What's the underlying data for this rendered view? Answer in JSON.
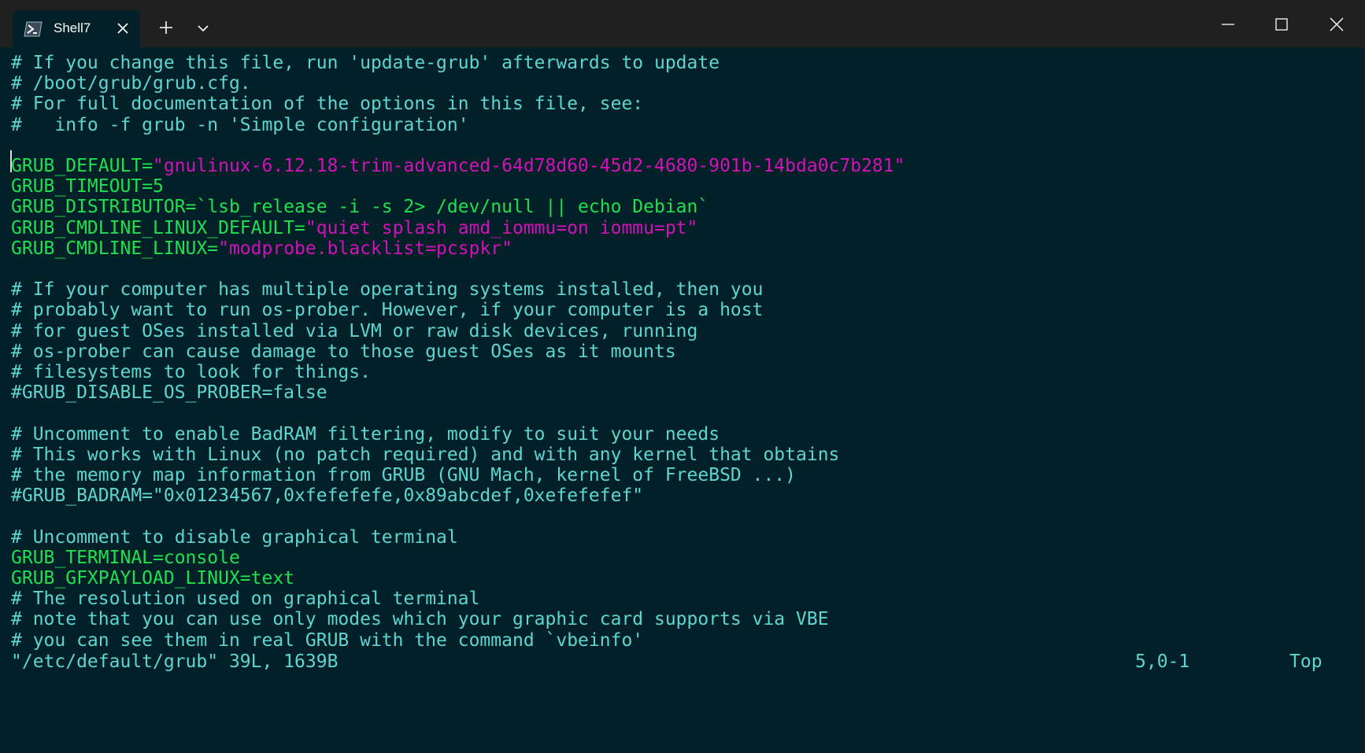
{
  "window": {
    "tab_title": "Shell7"
  },
  "icons": {
    "tab_icon": "powershell-icon",
    "tab_close": "close-icon",
    "new_tab": "plus-icon",
    "dropdown": "chevron-down-icon",
    "minimize": "minimize-icon",
    "maximize": "maximize-icon",
    "close": "close-icon"
  },
  "colors": {
    "background": "#012028",
    "comment": "#5dd6d2",
    "keyword": "#1fe04f",
    "string": "#d411b8",
    "titlebar": "#202020"
  },
  "editor": {
    "lines": [
      [
        {
          "t": "# If you change this file, run 'update-grub' afterwards to update",
          "c": "cm"
        }
      ],
      [
        {
          "t": "# /boot/grub/grub.cfg.",
          "c": "cm"
        }
      ],
      [
        {
          "t": "# For full documentation of the options in this file, see:",
          "c": "cm"
        }
      ],
      [
        {
          "t": "#   info -f grub -n 'Simple configuration'",
          "c": "cm"
        }
      ],
      [],
      [
        {
          "t": "GRUB_DEFAULT=",
          "c": "kw"
        },
        {
          "t": "\"gnulinux-6.12.18-trim-advanced-64d78d60-45d2-4680-901b-14bda0c7b281\"",
          "c": "st"
        }
      ],
      [
        {
          "t": "GRUB_TIMEOUT=5",
          "c": "kw"
        }
      ],
      [
        {
          "t": "GRUB_DISTRIBUTOR=`lsb_release -i -s 2> /dev/null || echo Debian`",
          "c": "kw"
        }
      ],
      [
        {
          "t": "GRUB_CMDLINE_LINUX_DEFAULT=",
          "c": "kw"
        },
        {
          "t": "\"quiet splash amd_iommu=on iommu=pt\"",
          "c": "st"
        }
      ],
      [
        {
          "t": "GRUB_CMDLINE_LINUX=",
          "c": "kw"
        },
        {
          "t": "\"modprobe.blacklist=pcspkr\"",
          "c": "st"
        }
      ],
      [],
      [
        {
          "t": "# If your computer has multiple operating systems installed, then you",
          "c": "cm"
        }
      ],
      [
        {
          "t": "# probably want to run os-prober. However, if your computer is a host",
          "c": "cm"
        }
      ],
      [
        {
          "t": "# for guest OSes installed via LVM or raw disk devices, running",
          "c": "cm"
        }
      ],
      [
        {
          "t": "# os-prober can cause damage to those guest OSes as it mounts",
          "c": "cm"
        }
      ],
      [
        {
          "t": "# filesystems to look for things.",
          "c": "cm"
        }
      ],
      [
        {
          "t": "#GRUB_DISABLE_OS_PROBER=false",
          "c": "cm"
        }
      ],
      [],
      [
        {
          "t": "# Uncomment to enable BadRAM filtering, modify to suit your needs",
          "c": "cm"
        }
      ],
      [
        {
          "t": "# This works with Linux (no patch required) and with any kernel that obtains",
          "c": "cm"
        }
      ],
      [
        {
          "t": "# the memory map information from GRUB (GNU Mach, kernel of FreeBSD ...)",
          "c": "cm"
        }
      ],
      [
        {
          "t": "#GRUB_BADRAM=\"0x01234567,0xfefefefe,0x89abcdef,0xefefefef\"",
          "c": "cm"
        }
      ],
      [],
      [
        {
          "t": "# Uncomment to disable graphical terminal",
          "c": "cm"
        }
      ],
      [
        {
          "t": "GRUB_TERMINAL=console",
          "c": "kw"
        }
      ],
      [
        {
          "t": "GRUB_GFXPAYLOAD_LINUX=text",
          "c": "kw"
        }
      ],
      [
        {
          "t": "# The resolution used on graphical terminal",
          "c": "cm"
        }
      ],
      [
        {
          "t": "# note that you can use only modes which your graphic card supports via VBE",
          "c": "cm"
        }
      ],
      [
        {
          "t": "# you can see them in real GRUB with the command `vbeinfo'",
          "c": "cm"
        }
      ]
    ]
  },
  "status": {
    "file_info": "\"/etc/default/grub\" 39L, 1639B",
    "cursor_pos": "5,0-1",
    "scroll": "Top"
  }
}
